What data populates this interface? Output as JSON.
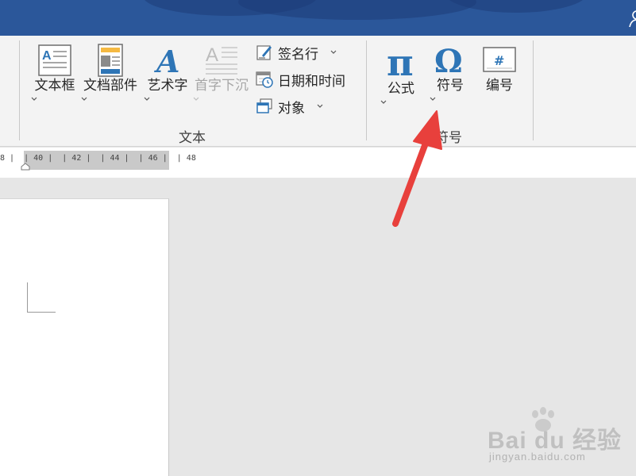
{
  "ribbon": {
    "text_group": {
      "label": "文本",
      "textbox_label": "文本框",
      "quickparts_label": "文档部件",
      "wordart_label": "艺术字",
      "dropcap_label": "首字下沉",
      "signature_label": "签名行",
      "datetime_label": "日期和时间",
      "object_label": "对象"
    },
    "symbols_group": {
      "label": "符号",
      "equation_label": "公式",
      "symbol_label": "符号",
      "number_label": "编号"
    }
  },
  "ruler": {
    "ticks_text": "8 |  | 40 |  | 42 |  | 44 |  | 46 |  | 48"
  },
  "watermark": {
    "brand": "Bai du 经验",
    "site": "jingyan.baidu.com"
  },
  "colors": {
    "title_bar": "#2b579a",
    "ribbon_bg": "#f3f3f3",
    "icon_blue": "#2e75b6",
    "arrow_red": "#e8403c"
  }
}
